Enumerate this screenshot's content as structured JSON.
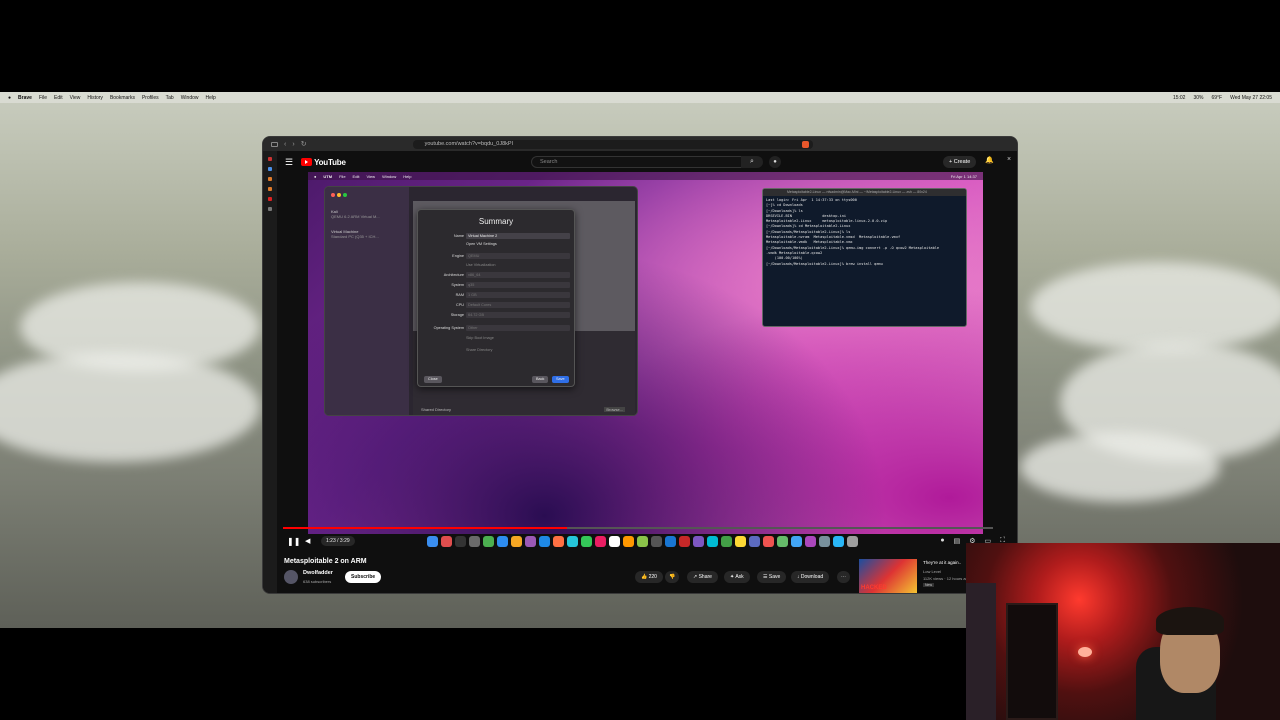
{
  "mac_menubar": {
    "app": "Brave",
    "items": [
      "File",
      "Edit",
      "View",
      "History",
      "Bookmarks",
      "Profiles",
      "Tab",
      "Window",
      "Help"
    ],
    "clock": "Wed May 27  22:05",
    "right_items": [
      "15:02",
      "30%",
      "69°F"
    ]
  },
  "browser": {
    "url": "youtube.com/watch?v=bqdu_0J8kPI"
  },
  "youtube": {
    "logo": "YouTube",
    "search_placeholder": "Search",
    "create_label": "Create"
  },
  "video_frame": {
    "utm_menubar": [
      "UTM",
      "File",
      "Edit",
      "View",
      "Window",
      "Help"
    ],
    "utm_menubar_right": "Fri Apr 1  14:37",
    "vm_list": [
      {
        "name": "Kali",
        "detail": "QEMU 6.2 ARM Virtual M..."
      },
      {
        "name": "Virtual Machine",
        "detail": "Standard PC (Q35 + ICH..."
      }
    ],
    "dialog": {
      "title": "Summary",
      "name_label": "Name",
      "name_value": "Virtual Machine 2",
      "open_vm_settings": "Open VM Settings",
      "engine_label": "Engine",
      "engine_value": "QEMU",
      "use_virtualization": "Use Virtualization",
      "architecture_label": "Architecture",
      "architecture_value": "x86_64",
      "system_label": "System",
      "system_value": "q35",
      "ram_label": "RAM",
      "ram_value": "1 GB",
      "cpu_label": "CPU",
      "cpu_value": "Default Cores",
      "storage_label": "Storage",
      "storage_value": "64.72 GB",
      "os_label": "Operating System",
      "os_value": "Other",
      "skip_boot_image": "Skip Boot Image",
      "share_directory": "Share Directory",
      "close_label": "Close",
      "back_label": "Back",
      "save_label": "Save"
    },
    "utm_bottom": {
      "shared_directory": "Shared Directory",
      "browse": "Browse..."
    },
    "terminal": {
      "title": "Metasploitable2-Linux — nfsadmin@Mac-Mini — ~/Metasploitable2-Linux — zsh — 80x24",
      "lines": [
        "Last login: Fri Apr  1 14:37:33 on ttys000",
        "[~]% cd Downloads",
        "[~/Downloads]% ls",
        "DRSEVILE.BIN              desktop.ini",
        "Metasploitable2-Linux     metasploitable-linux-2.0.0.zip",
        "[~/Downloads]% cd Metasploitable2-Linux",
        "[~/Downloads/Metasploitable2-Linux]% ls",
        "Metasploitable.nvram  Metasploitable.vmsd  Metasploitable.vmxf",
        "Metasploitable.vmdk   Metasploitable.vmx",
        "[~/Downloads/Metasploitable2-Linux]% qemu-img convert -p -O qcow2 Metasploitable",
        ".vmdk Metasploitable.qcow2",
        "    (100.00/100%)",
        "[~/Downloads/Metasploitable2-Linux]% brew install qemu"
      ]
    }
  },
  "player": {
    "time": "1:23 / 3:29",
    "progress": 0.4
  },
  "video_info": {
    "title": "Metasploitable 2 on ARM",
    "channel": "Dwolfadder",
    "subscribers": "638 subscribers",
    "subscribe_label": "Subscribe",
    "likes": "220",
    "share_label": "Share",
    "ask_label": "Ask",
    "save_label": "Save",
    "download_label": "Download"
  },
  "recommended": {
    "title": "They're at it again..",
    "channel": "Low Level",
    "meta": "112K views · 12 hours ago",
    "badge": "New",
    "thumb_text": "HACKED"
  },
  "colors": {
    "youtube_red": "#ff0000",
    "save_button_blue": "#2f6ee6"
  }
}
